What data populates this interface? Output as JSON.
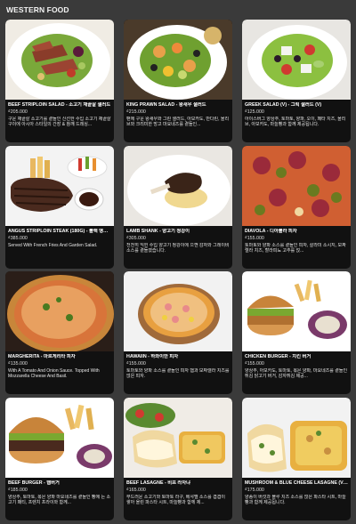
{
  "section_title": "WESTERN FOOD",
  "items": [
    {
      "name": "BEEF STRIPLOIN SALAD - 소고기 채끝살 샐러드",
      "price": "₫205.000",
      "desc": "구운 채끝살 소고기를 곁들인 신선한 수입 소고기 채끝살 구이에 아시아 스타일의 간장 & 참깨 드레싱..."
    },
    {
      "name": "KING PRAWN SALAD - 왕새우 샐러드",
      "price": "₫215.000",
      "desc": "팬에 구운 왕새우와 그린 샐러드, 아보카도, 만다린, 올리브와 크리미한 망고 마요네즈를 곁들인..."
    },
    {
      "name": "GREEK SALAD (V) - 그릭 샐러드 (V)",
      "price": "₫125.000",
      "desc": "아이스버그 양상추, 토마토, 양파, 오이, 페타 치즈, 올리브, 아보카도, 마늘빵과 함께 제공됩니다."
    },
    {
      "name": "ANGUS STRIPLOIN STEAK (180G) - 블랙 앵거...",
      "price": "₫385.000",
      "desc": "Served With French Fries And Garden Salad."
    },
    {
      "name": "LAMB SHANK - 양고기 정강이",
      "price": "₫305.000",
      "desc": "천천히 익힌 수입 양고기 정강이에 으깬 감자와 그레이비 소스를 곁들였습니다."
    },
    {
      "name": "DIAVOLA - 디아볼라 피자",
      "price": "₫155.000",
      "desc": "토마토와 양파 소스를 곁들인 피자, 살라미 소시지, 모짜렐라 치즈, 할라피뇨 고추를 얹..."
    },
    {
      "name": "MARGHERITA - 마르게리타 피자",
      "price": "₫135.000",
      "desc": "With A Tomato And Onion Sauce. Topped With Mozzarella Cheese And Basil."
    },
    {
      "name": "HAWAIIN - 하와이안 피자",
      "price": "₫155.000",
      "desc": "토마토와 양파 소스를 곁들인 피자 햄과 모짜렐라 치즈를 얹은 피자."
    },
    {
      "name": "CHICKEN BURGER - 치킨 버거",
      "price": "₫155.000",
      "desc": "양상추, 아보카도, 토마토, 볶은 양파, 마요네즈를 곁들인 튀김 닭고기 버거, 감자튀김 제공..."
    },
    {
      "name": "BEEF BURGER - 햄버거",
      "price": "₫185.000",
      "desc": "양상추, 토마토, 볶은 양파 마요네즈를 곁들인 빵에 든 소고기 패티, 프렌치 프라이와 함께..."
    },
    {
      "name": "BEEF LASAGNE - 비프 라자냐",
      "price": "₫165.000",
      "desc": "부드러운 소고기와 토마토 라구, 베샤멜 소스를 겹겹이 쌓아 올린 파스타 시트, 마늘빵과 함께 제..."
    },
    {
      "name": "MUSHROOM & BLUE CHEESE LASAGNE (V) -...",
      "price": "₫175.000",
      "desc": "양송이 버섯과 블루 치즈 소스를 얹은 파스타 시트, 마늘빵과 함께 제공됩니다."
    }
  ]
}
